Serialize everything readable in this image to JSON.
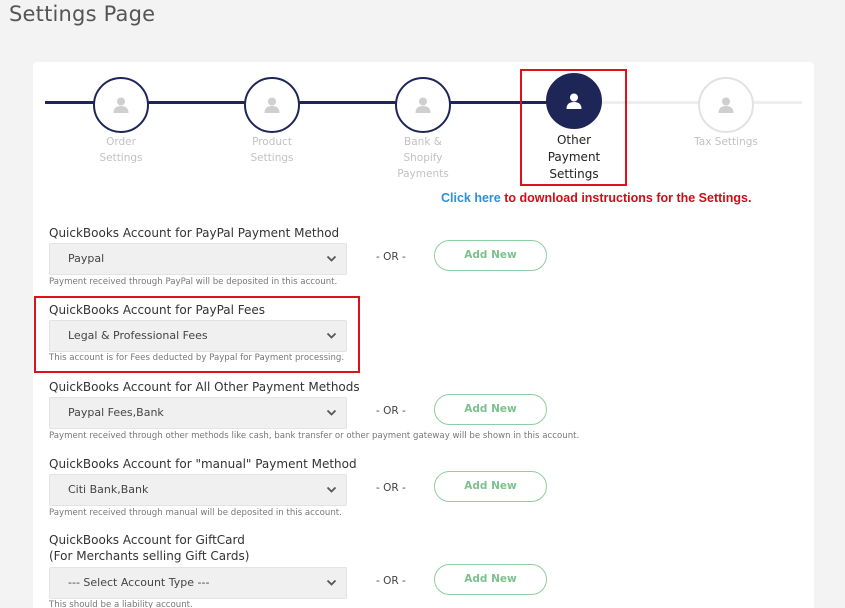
{
  "page": {
    "title": "Settings Page"
  },
  "stepper": {
    "steps": [
      {
        "label_lines": [
          "Order",
          "Settings"
        ],
        "state": "done"
      },
      {
        "label_lines": [
          "Product",
          "Settings"
        ],
        "state": "done"
      },
      {
        "label_lines": [
          "Bank &",
          "Shopify",
          "Payments"
        ],
        "state": "done"
      },
      {
        "label_lines": [
          "Other",
          "Payment",
          "Settings"
        ],
        "state": "active"
      },
      {
        "label_lines": [
          "Tax Settings"
        ],
        "state": "todo"
      }
    ]
  },
  "instructions": {
    "link_text": "Click here",
    "rest_text": "to download instructions for the Settings."
  },
  "fields": [
    {
      "label": "QuickBooks Account for PayPal Payment Method",
      "value": "Paypal",
      "help": "Payment received through PayPal will be deposited in this account.",
      "or_text": "- OR -",
      "add_label": "Add New"
    },
    {
      "label": "QuickBooks Account for PayPal Fees",
      "value": "Legal & Professional Fees",
      "help": "This account is for Fees deducted by Paypal for Payment processing."
    },
    {
      "label": "QuickBooks Account for All Other Payment Methods",
      "value": "Paypal Fees,Bank",
      "help": "Payment received through other methods like cash, bank transfer or other payment gateway will be shown in this account.",
      "or_text": "- OR -",
      "add_label": "Add New"
    },
    {
      "label": "QuickBooks Account for \"manual\" Payment Method",
      "value": "Citi Bank,Bank",
      "help": "Payment received through manual will be deposited in this account.",
      "or_text": "- OR -",
      "add_label": "Add New"
    },
    {
      "label_lines": [
        "QuickBooks Account for GiftCard",
        "(For Merchants selling Gift Cards)"
      ],
      "value": "--- Select Account Type ---",
      "help": "This should be a liability account.",
      "or_text": "- OR -",
      "add_label": "Add New"
    }
  ],
  "colors": {
    "navy": "#1e2658",
    "highlight_red": "#e0101a",
    "link_blue": "#2f8fd8",
    "button_green": "#7cc18d"
  },
  "icons": {
    "step_icon": "user-icon",
    "select_icon": "chevron-down-icon"
  }
}
